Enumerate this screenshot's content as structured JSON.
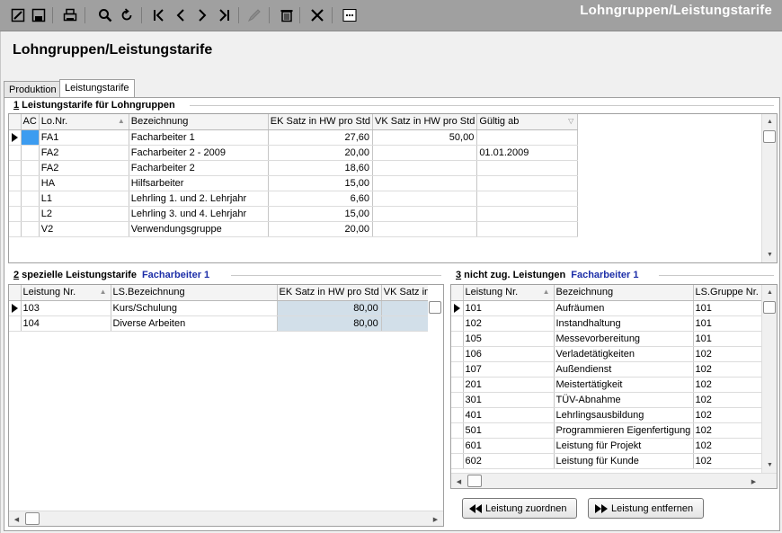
{
  "window": {
    "title": "Lohngruppen/Leistungstarife"
  },
  "page": {
    "title": "Lohngruppen/Leistungstarife"
  },
  "toolbar": {
    "icons": [
      "edit-icon",
      "save-icon",
      "print-icon",
      "search-icon",
      "refresh-icon",
      "first-record-icon",
      "previous-record-icon",
      "next-record-icon",
      "last-record-icon",
      "pen-icon",
      "delete-icon",
      "close-icon",
      "more-icon"
    ]
  },
  "tabs": [
    {
      "label": "Produktion",
      "active": false
    },
    {
      "label": "Leistungstarife",
      "active": true
    }
  ],
  "section1": {
    "number": "1",
    "title": " Leistungstarife für Lohngruppen",
    "columns": [
      "AC",
      "Lo.Nr.",
      "Bezeichnung",
      "EK Satz in HW pro Std",
      "VK Satz in HW pro Std",
      "Gültig ab"
    ],
    "rows": [
      {
        "lonr": "FA1",
        "bez": "Facharbeiter 1",
        "ek": "27,60",
        "vk": "50,00",
        "gueltig": ""
      },
      {
        "lonr": "FA2",
        "bez": "Facharbeiter 2 - 2009",
        "ek": "20,00",
        "vk": "",
        "gueltig": "01.01.2009"
      },
      {
        "lonr": "FA2",
        "bez": "Facharbeiter 2",
        "ek": "18,60",
        "vk": "",
        "gueltig": ""
      },
      {
        "lonr": "HA",
        "bez": "Hilfsarbeiter",
        "ek": "15,00",
        "vk": "",
        "gueltig": ""
      },
      {
        "lonr": "L1",
        "bez": "Lehrling 1. und 2. Lehrjahr",
        "ek": "6,60",
        "vk": "",
        "gueltig": ""
      },
      {
        "lonr": "L2",
        "bez": "Lehrling 3. und 4. Lehrjahr",
        "ek": "15,00",
        "vk": "",
        "gueltig": ""
      },
      {
        "lonr": "V2",
        "bez": "Verwendungsgruppe",
        "ek": "20,00",
        "vk": "",
        "gueltig": ""
      }
    ]
  },
  "section2": {
    "number": "2",
    "title": " spezielle Leistungstarife",
    "subtitle": "Facharbeiter 1",
    "columns": [
      "Leistung Nr.",
      "LS.Bezeichnung",
      "EK Satz in HW pro Std",
      "VK Satz in H"
    ],
    "rows": [
      {
        "nr": "103",
        "bez": "Kurs/Schulung",
        "ek": "80,00",
        "vk": ""
      },
      {
        "nr": "104",
        "bez": "Diverse Arbeiten",
        "ek": "80,00",
        "vk": ""
      }
    ]
  },
  "section3": {
    "number": "3",
    "title": " nicht zug. Leistungen",
    "subtitle": "Facharbeiter 1",
    "columns": [
      "Leistung Nr.",
      "Bezeichnung",
      "LS.Gruppe Nr."
    ],
    "rows": [
      {
        "nr": "101",
        "bez": "Aufräumen",
        "gruppe": "101"
      },
      {
        "nr": "102",
        "bez": "Instandhaltung",
        "gruppe": "101"
      },
      {
        "nr": "105",
        "bez": "Messevorbereitung",
        "gruppe": "101"
      },
      {
        "nr": "106",
        "bez": "Verladetätigkeiten",
        "gruppe": "102"
      },
      {
        "nr": "107",
        "bez": "Außendienst",
        "gruppe": "102"
      },
      {
        "nr": "201",
        "bez": "Meistertätigkeit",
        "gruppe": "102"
      },
      {
        "nr": "301",
        "bez": "TÜV-Abnahme",
        "gruppe": "102"
      },
      {
        "nr": "401",
        "bez": "Lehrlingsausbildung",
        "gruppe": "102"
      },
      {
        "nr": "501",
        "bez": "Programmieren Eigenfertigung",
        "gruppe": "102"
      },
      {
        "nr": "601",
        "bez": "Leistung für Projekt",
        "gruppe": "102"
      },
      {
        "nr": "602",
        "bez": "Leistung für Kunde",
        "gruppe": "102"
      }
    ],
    "buttons": {
      "assign": "Leistung zuordnen",
      "remove": "Leistung entfernen"
    }
  },
  "colors": {
    "toolbar": "#a0a0a0",
    "accent_blue": "#1c2ea8",
    "selected_cell": "#3c9cf0",
    "shaded_cell": "#d2dfe9"
  }
}
